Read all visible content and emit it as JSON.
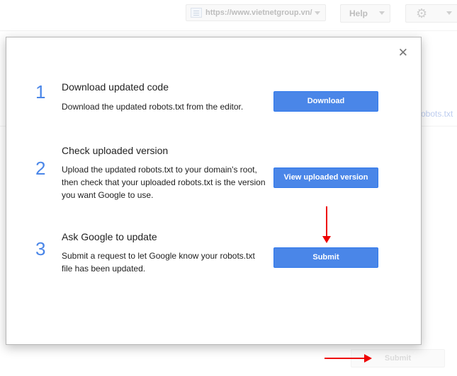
{
  "header": {
    "site_url": "https://www.vietnetgroup.vn/",
    "help_label": "Help"
  },
  "background": {
    "link_text": "robots.txt",
    "submit_label": "Submit"
  },
  "dialog": {
    "close_glyph": "✕",
    "steps": [
      {
        "number": "1",
        "title": "Download updated code",
        "description": "Download the updated robots.txt from the editor.",
        "button_label": "Download"
      },
      {
        "number": "2",
        "title": "Check uploaded version",
        "description": "Upload the updated robots.txt to your domain's root, then check that your uploaded robots.txt is the version you want Google to use.",
        "button_label": "View uploaded version"
      },
      {
        "number": "3",
        "title": "Ask Google to update",
        "description": "Submit a request to let Google know your robots.txt file has been updated.",
        "button_label": "Submit"
      }
    ]
  },
  "colors": {
    "accent": "#4a86e8",
    "annotation_arrow": "#e00000"
  },
  "icons": {
    "site_icon": "site-page-icon",
    "settings_icon": "gear-icon"
  }
}
